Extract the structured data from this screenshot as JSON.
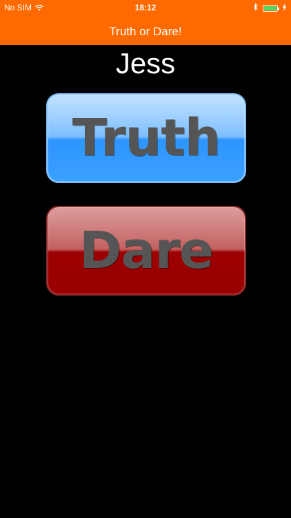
{
  "status_bar": {
    "carrier": "No SIM",
    "time": "18:12",
    "icons": [
      "wifi-icon",
      "bluetooth-icon",
      "battery-icon",
      "charging-bolt-icon"
    ],
    "battery_level": 1.0
  },
  "nav": {
    "title": "Truth or Dare!",
    "color": "#ff6a00"
  },
  "player": {
    "name": "Jess"
  },
  "buttons": {
    "truth_label": "Truth",
    "truth_color": "#3aa0ff",
    "dare_label": "Dare",
    "dare_color": "#9a0000"
  }
}
